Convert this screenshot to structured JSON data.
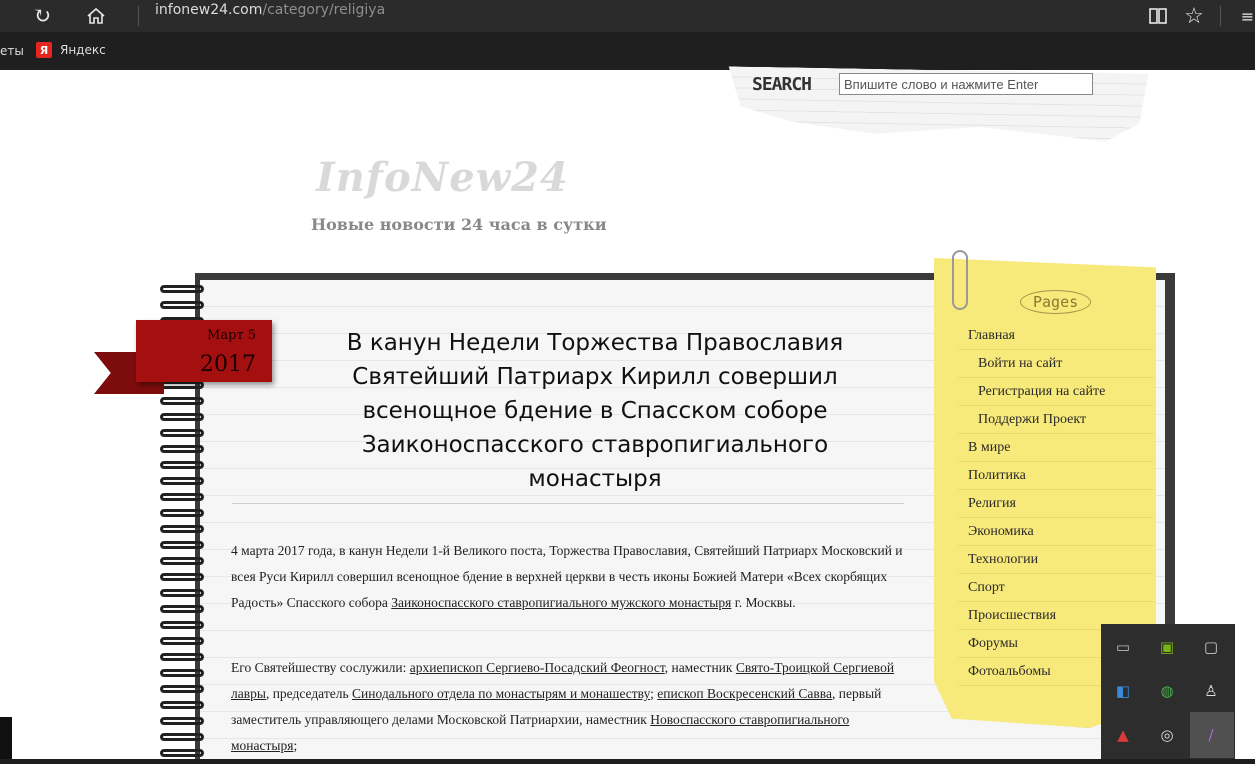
{
  "browser": {
    "url_host": "infonew24.com",
    "url_path": "/category/religiya",
    "bookmarks": [
      {
        "label": "еты"
      },
      {
        "label": "Яндекс"
      }
    ],
    "icons": [
      "refresh-icon",
      "home-icon",
      "reading-view-icon",
      "favorite-star-icon",
      "more-icon"
    ]
  },
  "search": {
    "label": "SEARCH",
    "placeholder": "Впишите слово и нажмите Enter"
  },
  "site": {
    "logo": "InfoNew24",
    "tagline": "Новые новости 24 часа в сутки"
  },
  "post": {
    "date_day": "Март 5",
    "date_year": "2017",
    "title": "В канун Недели Торжества Православия Святейший Патриарх Кирилл совершил всенощное бдение в Спасском соборе Заиконоспасского ставропигиального монастыря",
    "p1_text": "4 марта 2017 года, в канун Недели 1-й Великого поста, Торжества Православия, Святейший Патриарх Московский и всея Руси Кирилл совершил всенощное бдение в верхней церкви в честь иконы Божией Матери «Всех скорбящих Радость» Спасского собора ",
    "p1_link": "Заиконоспасского ставропигиального мужского монастыря",
    "p1_end": " г. Москвы.",
    "p2_a": "Его Святейшеству сослужили: ",
    "p2_link1": "архиепископ Сергиево-Посадский Феогност",
    "p2_b": ", наместник ",
    "p2_link2": "Свято-Троицкой Сергиевой лавры",
    "p2_c": ", председатель ",
    "p2_link3": "Синодального отдела по монастырям и монашеству",
    "p2_d": "; ",
    "p2_link4": "епископ Воскресенский Савва",
    "p2_e": ", первый заместитель управляющего делами Московской Патриархии, наместник ",
    "p2_link5": "Новоспасского ставропигиального монастыря",
    "p2_f": ";"
  },
  "sidebar": {
    "heading": "Pages",
    "items": [
      {
        "label": "Главная"
      },
      {
        "label": "Войти на сайт"
      },
      {
        "label": "Регистрация на сайте"
      },
      {
        "label": "Поддержи Проект"
      },
      {
        "label": "В мире"
      },
      {
        "label": "Политика"
      },
      {
        "label": "Религия"
      },
      {
        "label": "Экономика"
      },
      {
        "label": "Технологии"
      },
      {
        "label": "Спорт"
      },
      {
        "label": "Происшествия"
      },
      {
        "label": "Форумы"
      },
      {
        "label": "Фотоальбомы"
      }
    ]
  },
  "tray_icons": [
    "usb-drive-icon",
    "nvidia-icon",
    "tablet-icon",
    "network-app-icon",
    "browser-app-icon",
    "usb-device-icon",
    "antivirus-icon",
    "sync-icon",
    "pen-icon"
  ]
}
